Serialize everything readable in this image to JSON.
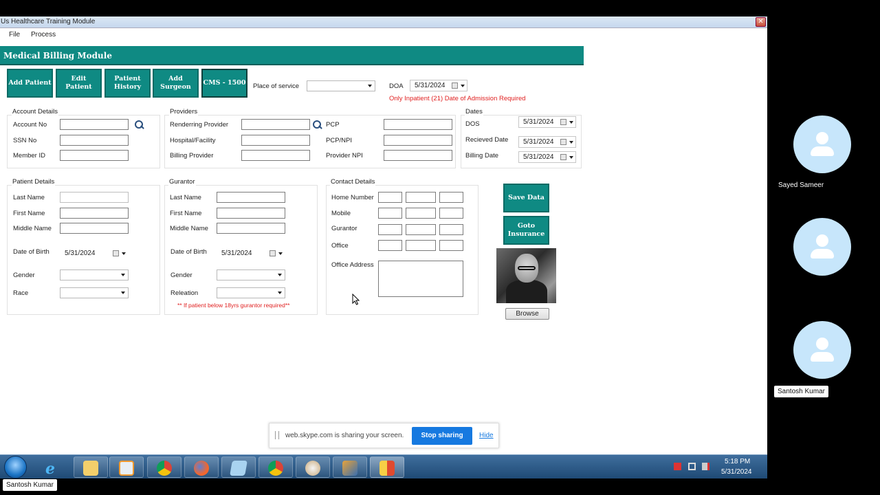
{
  "window": {
    "title": "Us Healthcare Training Module",
    "close": "✕"
  },
  "menu": {
    "file": "File",
    "process": "Process"
  },
  "module": {
    "header": "Medical Billing Module"
  },
  "toolbar": {
    "add_patient": "Add Patient",
    "edit_patient": "Edit Patient",
    "patient_history": "Patient History",
    "add_surgeon": "Add Surgeon",
    "cms": "CMS - 1500"
  },
  "top": {
    "place_label": "Place of service",
    "doa_label": "DOA",
    "doa_value": "5/31/2024",
    "doa_note": "Only Inpatient (21) Date of Admission Required"
  },
  "account": {
    "title": "Account Details",
    "account_no": "Account No",
    "ssn_no": "SSN No",
    "member_id": "Member ID"
  },
  "providers": {
    "title": "Providers",
    "rendering": "Renderring Provider",
    "hospital": "Hospital/Facility",
    "billing": "Billing Provider",
    "pcp": "PCP",
    "pcp_npi": "PCP/NPI",
    "provider_npi": "Provider NPI"
  },
  "dates": {
    "title": "Dates",
    "dos_label": "DOS",
    "dos_value": "5/31/2024",
    "received_label": "Recieved Date",
    "received_value": "5/31/2024",
    "billing_label": "Billing Date",
    "billing_value": "5/31/2024"
  },
  "patient": {
    "title": "Patient Details",
    "last_name": "Last Name",
    "first_name": "First Name",
    "middle_name": "Middle Name",
    "dob_label": "Date of Birth",
    "dob_value": "5/31/2024",
    "gender": "Gender",
    "race": "Race"
  },
  "gurantor": {
    "title": "Gurantor",
    "last_name": "Last Name",
    "first_name": "First Name",
    "middle_name": "Middle Name",
    "dob_label": "Date of Birth",
    "dob_value": "5/31/2024",
    "gender": "Gender",
    "relation": "Releation",
    "note": "** If patient below 18yrs gurantor required**"
  },
  "contact": {
    "title": "Contact Details",
    "home": "Home Number",
    "mobile": "Mobile",
    "gurantor": "Gurantor",
    "office": "Office",
    "office_address": "Office Address"
  },
  "actions": {
    "save": "Save Data",
    "goto_insurance": "Goto Insurance",
    "browse": "Browse"
  },
  "share": {
    "message": "web.skype.com is sharing your screen.",
    "stop": "Stop sharing",
    "hide": "Hide"
  },
  "tray": {
    "time": "5:18 PM",
    "date": "5/31/2024"
  },
  "participants": [
    "Sayed Sameer",
    "",
    "Santosh Kumar"
  ],
  "self_name": "Santosh Kumar",
  "colors": {
    "teal": "#0f8a83",
    "share_blue": "#1679e0"
  }
}
